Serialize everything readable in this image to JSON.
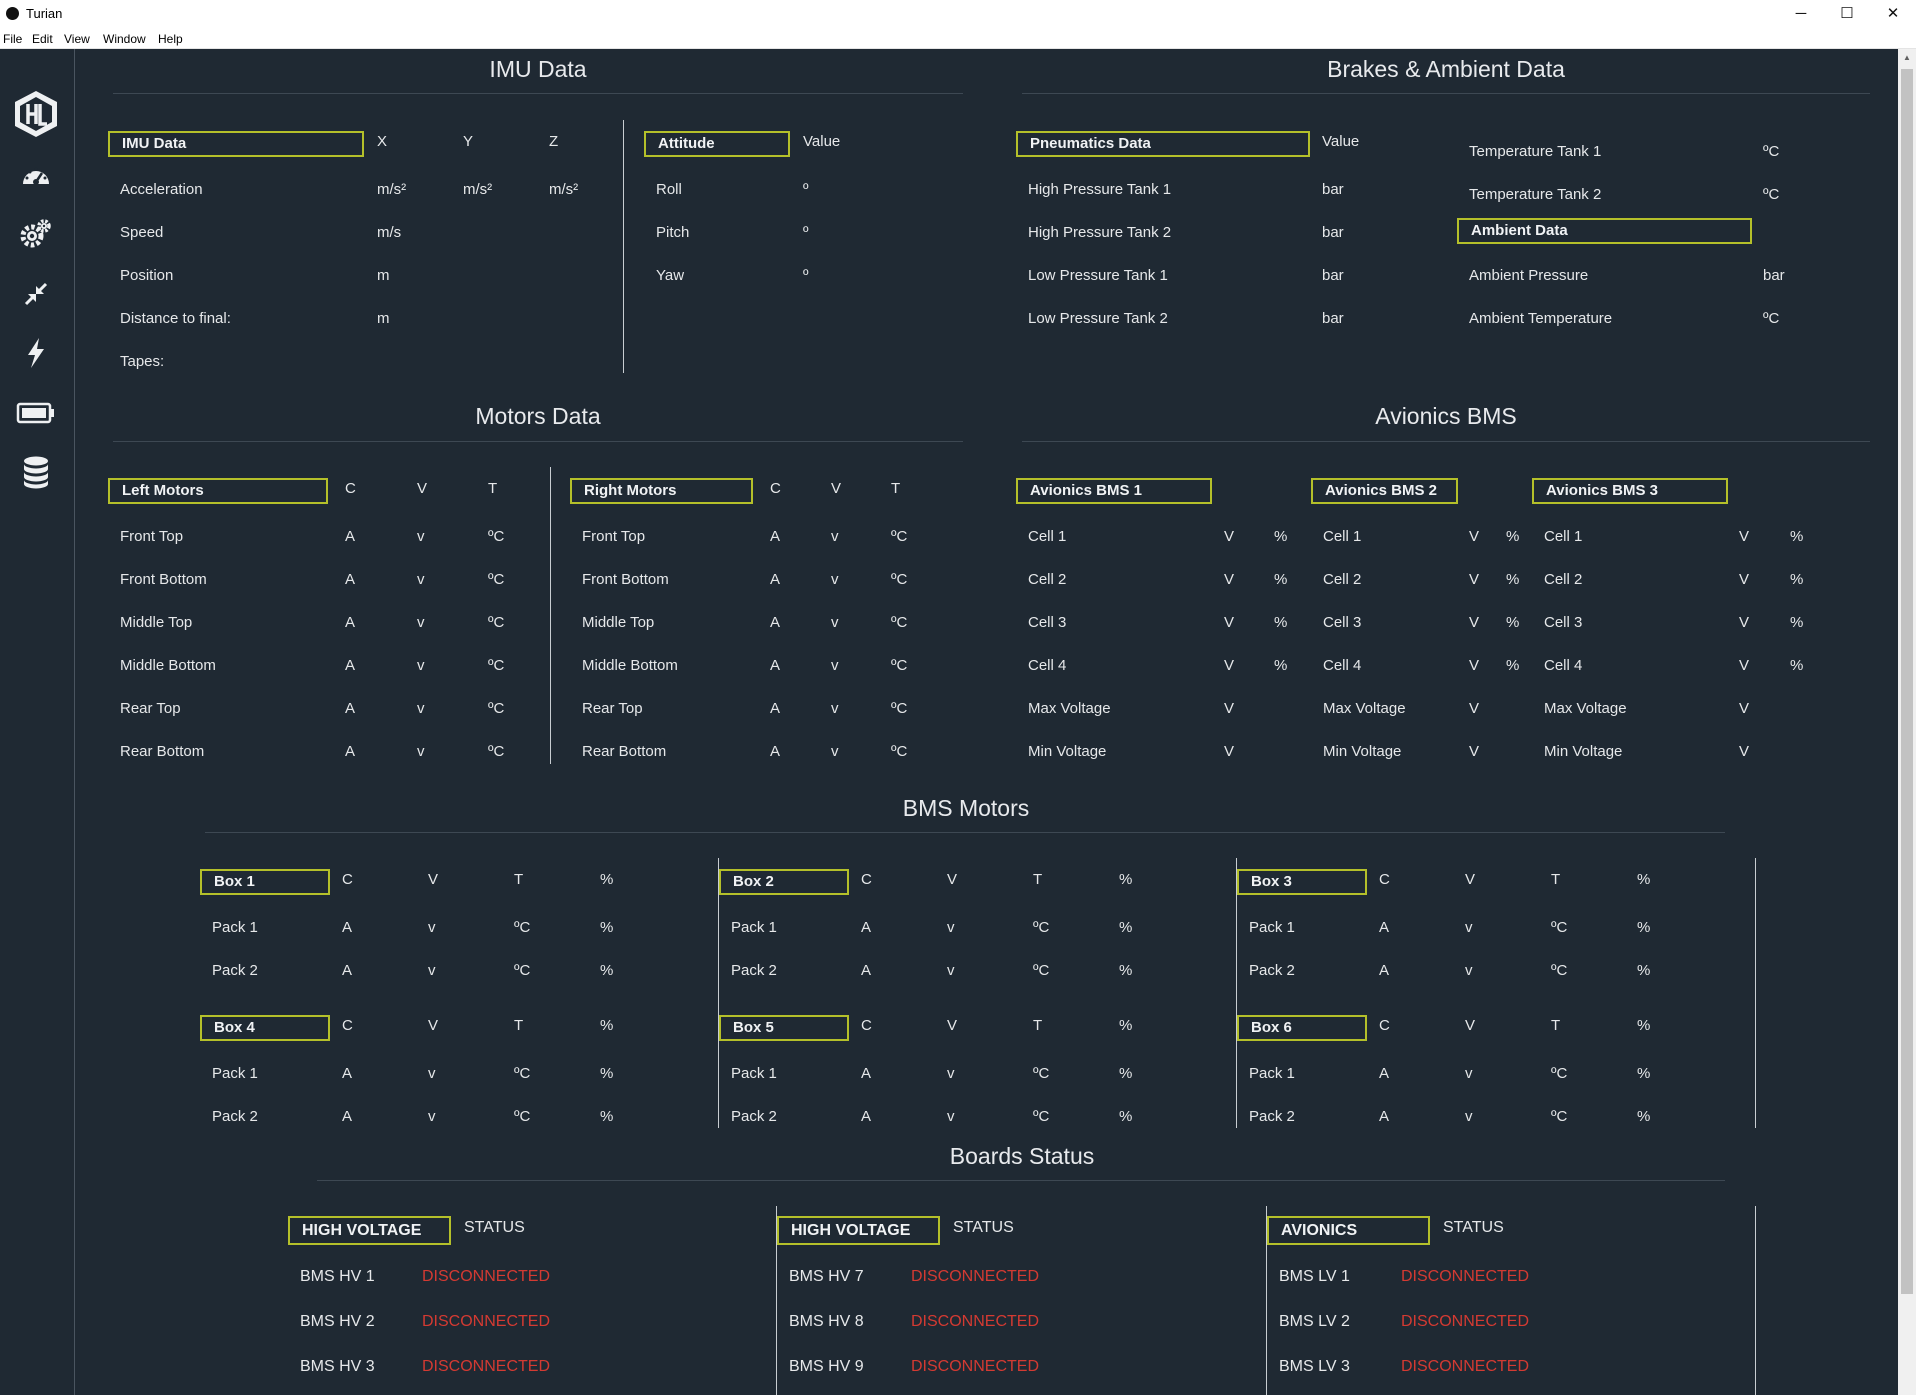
{
  "window": {
    "title": "Turian",
    "minimize": "─",
    "maximize": "☐",
    "close": "✕"
  },
  "menu": [
    "File",
    "Edit",
    "View",
    "Window",
    "Help"
  ],
  "nav": [
    "logo-icon",
    "dashboard-icon",
    "settings-icon",
    "collapse-icon",
    "power-icon",
    "battery-icon",
    "database-icon"
  ],
  "colors": {
    "background": "#1f2933",
    "accent": "#b4c02a",
    "error": "#d43a32"
  },
  "imu": {
    "section_title": "IMU Data",
    "table": {
      "header": "IMU Data",
      "cols": [
        "X",
        "Y",
        "Z"
      ],
      "rows": [
        {
          "label": "Acceleration",
          "units": [
            "m/s²",
            "m/s²",
            "m/s²"
          ]
        },
        {
          "label": "Speed",
          "units": [
            "m/s"
          ]
        },
        {
          "label": "Position",
          "units": [
            "m"
          ]
        },
        {
          "label": "Distance to final:",
          "units": [
            "m"
          ]
        },
        {
          "label": "Tapes:",
          "units": []
        }
      ]
    },
    "attitude": {
      "header": "Attitude",
      "col": "Value",
      "rows": [
        {
          "label": "Roll",
          "unit": "º"
        },
        {
          "label": "Pitch",
          "unit": "º"
        },
        {
          "label": "Yaw",
          "unit": "º"
        }
      ]
    }
  },
  "brakes": {
    "section_title": "Brakes & Ambient Data",
    "pneumatics": {
      "header": "Pneumatics Data",
      "col": "Value",
      "rows": [
        {
          "label": "High Pressure Tank 1",
          "unit": "bar"
        },
        {
          "label": "High Pressure Tank 2",
          "unit": "bar"
        },
        {
          "label": "Low Pressure Tank 1",
          "unit": "bar"
        },
        {
          "label": "Low Pressure Tank 2",
          "unit": "bar"
        }
      ]
    },
    "temperature": [
      {
        "label": "Temperature Tank 1",
        "unit": "ºC"
      },
      {
        "label": "Temperature Tank 2",
        "unit": "ºC"
      }
    ],
    "ambient": {
      "header": "Ambient Data",
      "rows": [
        {
          "label": "Ambient Pressure",
          "unit": "bar"
        },
        {
          "label": "Ambient Temperature",
          "unit": "ºC"
        }
      ]
    }
  },
  "motors": {
    "section_title": "Motors Data",
    "cols": [
      "C",
      "V",
      "T"
    ],
    "units": [
      "A",
      "v",
      "ºC"
    ],
    "left_header": "Left Motors",
    "right_header": "Right Motors",
    "rows": [
      "Front Top",
      "Front Bottom",
      "Middle Top",
      "Middle Bottom",
      "Rear Top",
      "Rear Bottom"
    ]
  },
  "avionics": {
    "section_title": "Avionics BMS",
    "blocks": [
      {
        "header": "Avionics BMS 1"
      },
      {
        "header": "Avionics BMS 2"
      },
      {
        "header": "Avionics BMS 3"
      }
    ],
    "rows": [
      {
        "label": "Cell 1",
        "unit": "V",
        "pct": "%"
      },
      {
        "label": "Cell 2",
        "unit": "V",
        "pct": "%"
      },
      {
        "label": "Cell 3",
        "unit": "V",
        "pct": "%"
      },
      {
        "label": "Cell 4",
        "unit": "V",
        "pct": "%"
      },
      {
        "label": "Max Voltage",
        "unit": "V",
        "pct": ""
      },
      {
        "label": "Min Voltage",
        "unit": "V",
        "pct": ""
      }
    ]
  },
  "bms_motors": {
    "section_title": "BMS Motors",
    "cols": [
      "C",
      "V",
      "T",
      "%"
    ],
    "units": [
      "A",
      "v",
      "ºC",
      "%"
    ],
    "packs": [
      "Pack 1",
      "Pack 2"
    ],
    "boxes": [
      "Box 1",
      "Box 2",
      "Box 3",
      "Box 4",
      "Box 5",
      "Box 6"
    ]
  },
  "boards": {
    "section_title": "Boards Status",
    "status_col": "STATUS",
    "groups": [
      {
        "header": "HIGH VOLTAGE",
        "rows": [
          {
            "label": "BMS HV 1",
            "status": "DISCONNECTED"
          },
          {
            "label": "BMS HV 2",
            "status": "DISCONNECTED"
          },
          {
            "label": "BMS HV 3",
            "status": "DISCONNECTED"
          }
        ]
      },
      {
        "header": "HIGH VOLTAGE",
        "rows": [
          {
            "label": "BMS HV 7",
            "status": "DISCONNECTED"
          },
          {
            "label": "BMS HV 8",
            "status": "DISCONNECTED"
          },
          {
            "label": "BMS HV 9",
            "status": "DISCONNECTED"
          }
        ]
      },
      {
        "header": "AVIONICS",
        "rows": [
          {
            "label": "BMS LV 1",
            "status": "DISCONNECTED"
          },
          {
            "label": "BMS LV 2",
            "status": "DISCONNECTED"
          },
          {
            "label": "BMS LV 3",
            "status": "DISCONNECTED"
          }
        ]
      }
    ]
  }
}
